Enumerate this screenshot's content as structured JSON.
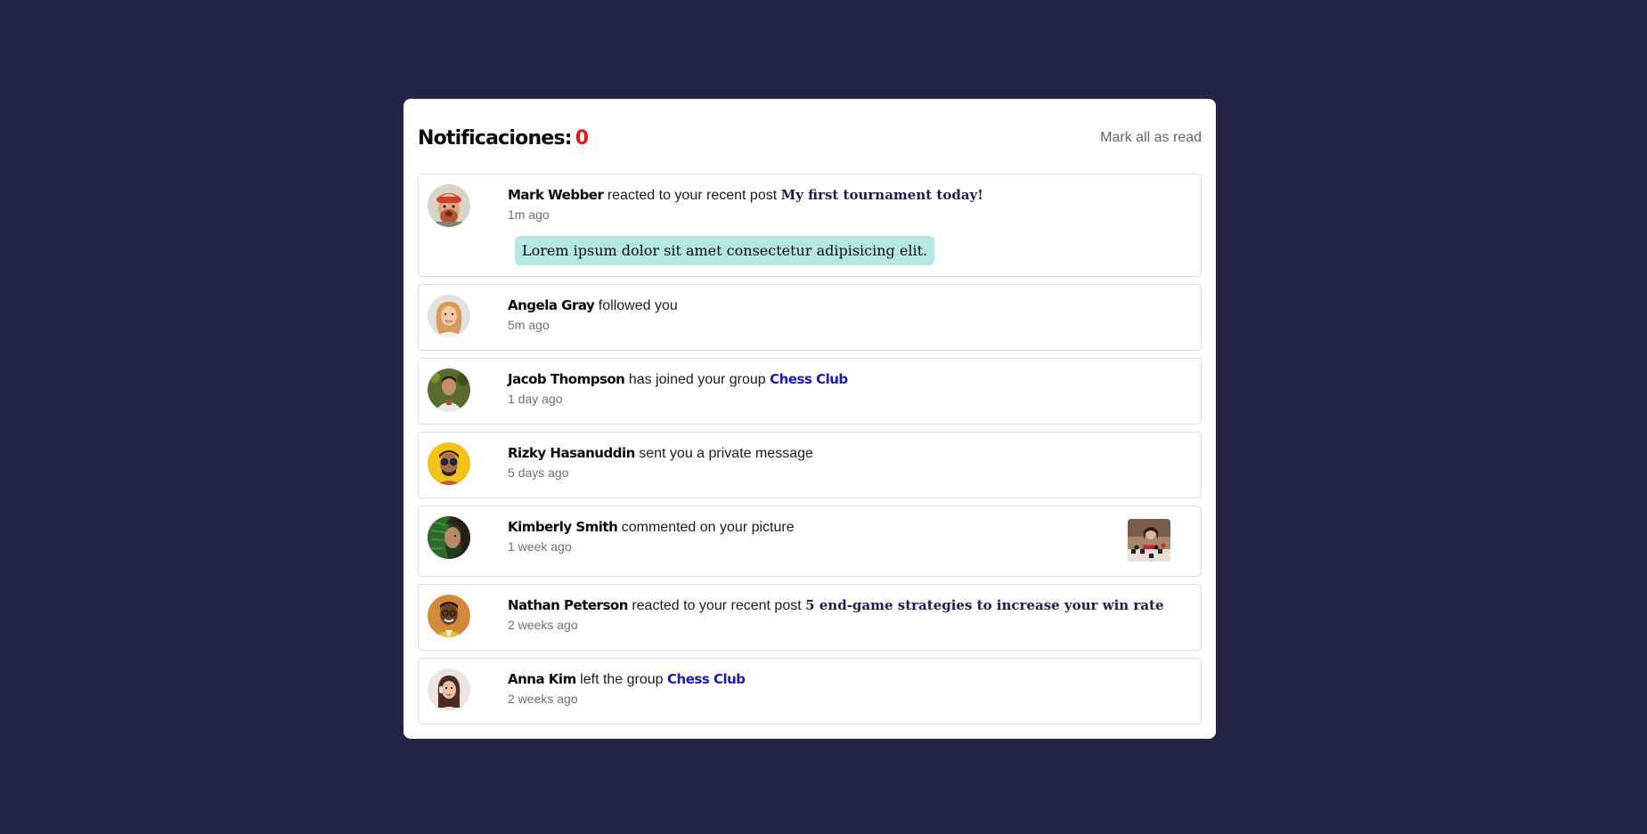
{
  "header": {
    "title": "Notificaciones:",
    "count": "0",
    "mark_all": "Mark all as read"
  },
  "notifications": [
    {
      "name": "Mark Webber",
      "action": "reacted to your recent post",
      "post": "My first tournament today!",
      "time": "1m ago",
      "message": "Lorem ipsum dolor sit amet consectetur adipisicing elit."
    },
    {
      "name": "Angela Gray",
      "action": "followed you",
      "time": "5m ago"
    },
    {
      "name": "Jacob Thompson",
      "action": "has joined your group",
      "group": "Chess Club",
      "time": "1 day ago"
    },
    {
      "name": "Rizky Hasanuddin",
      "action": "sent you a private message",
      "time": "5 days ago"
    },
    {
      "name": "Kimberly Smith",
      "action": "commented on your picture",
      "time": "1 week ago"
    },
    {
      "name": "Nathan Peterson",
      "action": "reacted to your recent post",
      "post": "5 end-game strategies to increase your win rate",
      "time": "2 weeks ago"
    },
    {
      "name": "Anna Kim",
      "action": "left the group",
      "group": "Chess Club",
      "time": "2 weeks ago"
    }
  ],
  "colors": {
    "background": "#262445",
    "card": "#ffffff",
    "count": "#e8141a",
    "post_link": "#1e1a55",
    "group_link": "#1a1ab8",
    "message_bg": "#b6e6e2"
  }
}
